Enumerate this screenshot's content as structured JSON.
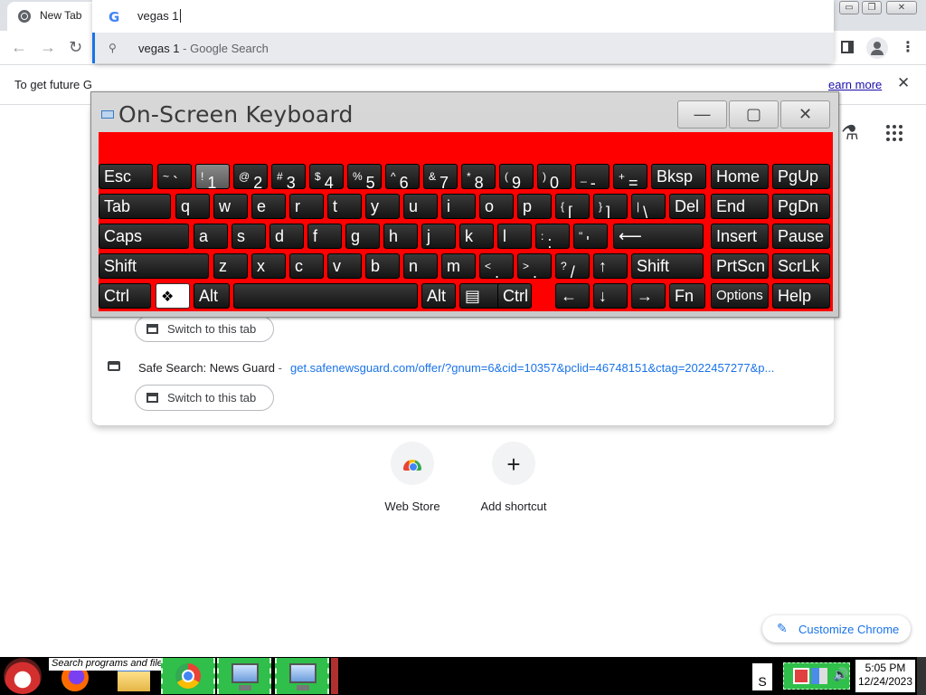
{
  "browser": {
    "tab_title": "New Tab",
    "tab_close": "✕",
    "new_tab": "+",
    "tab_search": "⌄",
    "window_min": "▭",
    "window_max": "❐",
    "window_close": "✕"
  },
  "toolbar": {
    "back": "←",
    "forward": "→",
    "reload": "↻",
    "google_g": "G",
    "omnibox_value": "vegas 1",
    "menu": "⋮"
  },
  "omnibox_dropdown": {
    "suggestion_text": "vegas 1",
    "suggestion_desc": " - Google Search",
    "switch_tab_label": "Switch to this tab",
    "news_title": "Safe Search: News Guard",
    "news_sep": "-",
    "news_url": "get.safenewsguard.com/offer/?gnum=6&cid=10357&pclid=46748151&ctag=2022457277&p..."
  },
  "infobar": {
    "text": "To get future G",
    "link": "earn more",
    "close": "✕"
  },
  "ntp": {
    "labs_icon": "⚗",
    "shortcuts": [
      {
        "label": "Web Store"
      },
      {
        "label": "Add shortcut",
        "icon": "+"
      }
    ],
    "customize_label": "Customize Chrome",
    "customize_icon": "✎"
  },
  "osk": {
    "title": "On-Screen Keyboard",
    "min": "—",
    "max": "▢",
    "close": "✕",
    "rows": [
      [
        {
          "t": "Esc"
        },
        {
          "s": "~",
          "m": "`"
        },
        {
          "s": "!",
          "m": "1",
          "pressed": true
        },
        {
          "s": "@",
          "m": "2"
        },
        {
          "s": "#",
          "m": "3"
        },
        {
          "s": "$",
          "m": "4"
        },
        {
          "s": "%",
          "m": "5"
        },
        {
          "s": "^",
          "m": "6"
        },
        {
          "s": "&",
          "m": "7"
        },
        {
          "s": "*",
          "m": "8"
        },
        {
          "s": "(",
          "m": "9"
        },
        {
          "s": ")",
          "m": "0"
        },
        {
          "s": "_",
          "m": "-"
        },
        {
          "s": "+",
          "m": "="
        },
        {
          "t": "Bksp"
        },
        {
          "t": "Home"
        },
        {
          "t": "PgUp"
        }
      ],
      [
        {
          "t": "Tab"
        },
        {
          "t": "q"
        },
        {
          "t": "w"
        },
        {
          "t": "e"
        },
        {
          "t": "r"
        },
        {
          "t": "t"
        },
        {
          "t": "y"
        },
        {
          "t": "u"
        },
        {
          "t": "i"
        },
        {
          "t": "o"
        },
        {
          "t": "p"
        },
        {
          "s": "{",
          "m": "["
        },
        {
          "s": "}",
          "m": "]"
        },
        {
          "s": "|",
          "m": "\\"
        },
        {
          "t": "Del"
        },
        {
          "t": "End"
        },
        {
          "t": "PgDn"
        }
      ],
      [
        {
          "t": "Caps"
        },
        {
          "t": "a"
        },
        {
          "t": "s"
        },
        {
          "t": "d"
        },
        {
          "t": "f"
        },
        {
          "t": "g"
        },
        {
          "t": "h"
        },
        {
          "t": "j"
        },
        {
          "t": "k"
        },
        {
          "t": "l"
        },
        {
          "s": ":",
          "m": ";"
        },
        {
          "s": "\"",
          "m": "'"
        },
        {
          "t": "⟵"
        },
        {
          "t": "Insert"
        },
        {
          "t": "Pause"
        }
      ],
      [
        {
          "t": "Shift"
        },
        {
          "t": "z"
        },
        {
          "t": "x"
        },
        {
          "t": "c"
        },
        {
          "t": "v"
        },
        {
          "t": "b"
        },
        {
          "t": "n"
        },
        {
          "t": "m"
        },
        {
          "s": "<",
          "m": ","
        },
        {
          "s": ">",
          "m": "."
        },
        {
          "s": "?",
          "m": "/"
        },
        {
          "t": "↑"
        },
        {
          "t": "Shift"
        },
        {
          "t": "PrtScn"
        },
        {
          "t": "ScrLk"
        }
      ],
      [
        {
          "t": "Ctrl"
        },
        {
          "t": "win",
          "win": true
        },
        {
          "t": "Alt"
        },
        {
          "t": ""
        },
        {
          "t": "Alt"
        },
        {
          "t": "▤"
        },
        {
          "t": "Ctrl"
        },
        {
          "t": "←"
        },
        {
          "t": "↓"
        },
        {
          "t": "→"
        },
        {
          "t": "Fn"
        },
        {
          "t": "Options",
          "small": true
        },
        {
          "t": "Help"
        }
      ]
    ]
  },
  "taskbar": {
    "search_placeholder": "Search programs and files",
    "tray_box": "S",
    "tray_volume": "🔊",
    "time": "5:05 PM",
    "date": "12/24/2023"
  }
}
